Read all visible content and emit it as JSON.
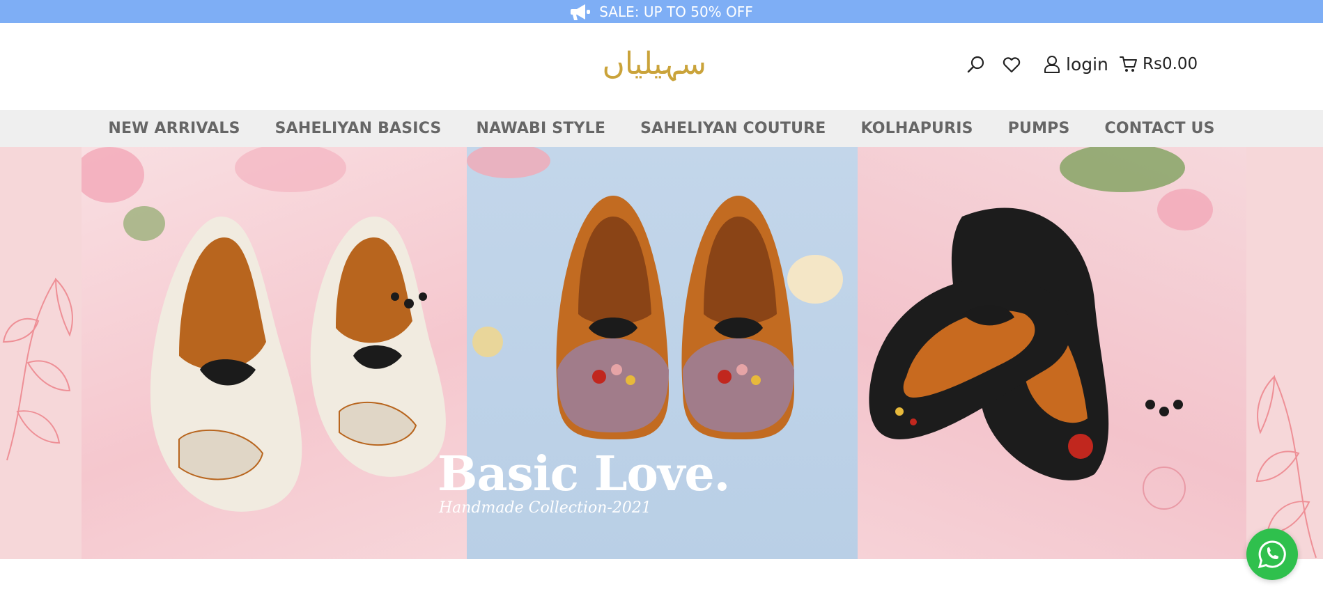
{
  "announcement": {
    "text": "SALE: UP TO 50% OFF",
    "icon": "megaphone-icon"
  },
  "header": {
    "logo_text": "سہیلیاں",
    "search_icon": "search-icon",
    "wishlist_icon": "heart-icon",
    "login_label": "login",
    "cart_total": "Rs0.00"
  },
  "nav": {
    "items": [
      {
        "label": "NEW ARRIVALS"
      },
      {
        "label": "SAHELIYAN BASICS"
      },
      {
        "label": "NAWABI STYLE"
      },
      {
        "label": "SAHELIYAN COUTURE"
      },
      {
        "label": "KOLHAPURIS"
      },
      {
        "label": "PUMPS"
      },
      {
        "label": "CONTACT US"
      }
    ]
  },
  "hero": {
    "title": "Basic Love.",
    "subtitle": "Handmade Collection-2021"
  },
  "colors": {
    "announcement_bg": "#7eaef5",
    "logo_gold": "#caa33a",
    "nav_bg": "#efefef",
    "whatsapp_green": "#2fc04d"
  }
}
